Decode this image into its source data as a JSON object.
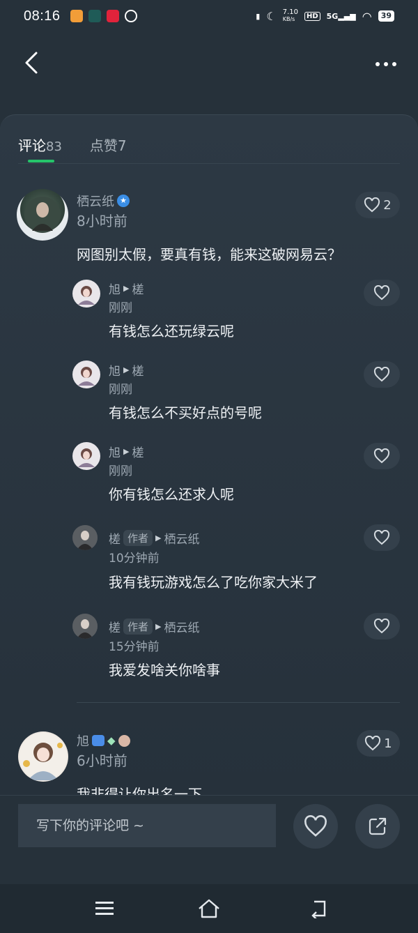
{
  "status": {
    "time": "08:16",
    "net_speed": "7.10",
    "net_unit": "KB/s",
    "hd": "HD",
    "signal": "5G",
    "battery": "39"
  },
  "tabs": [
    {
      "label": "评论",
      "count": "83"
    },
    {
      "label": "点赞7",
      "count": ""
    }
  ],
  "comments": [
    {
      "user": "栖云纸",
      "time": "8小时前",
      "likes": "2",
      "text": "网图别太假，要真有钱，能来这破网易云？",
      "replies": [
        {
          "user": "旭",
          "target": "槎",
          "time": "刚刚",
          "text": "有钱怎么还玩绿云呢"
        },
        {
          "user": "旭",
          "target": "槎",
          "time": "刚刚",
          "text": "有钱怎么不买好点的号呢"
        },
        {
          "user": "旭",
          "target": "槎",
          "time": "刚刚",
          "text": "你有钱怎么还求人呢"
        },
        {
          "user": "槎",
          "badge": "作者",
          "target": "栖云纸",
          "time": "10分钟前",
          "text": "我有钱玩游戏怎么了吃你家大米了"
        },
        {
          "user": "槎",
          "badge": "作者",
          "target": "栖云纸",
          "time": "15分钟前",
          "text": "我爱发啥关你啥事"
        }
      ]
    },
    {
      "user": "旭",
      "time": "6小时前",
      "likes": "1",
      "text": "我非得让你出名一下"
    }
  ],
  "composer": {
    "placeholder": "写下你的评论吧 ~"
  },
  "colors": {
    "accent": "#25c46a",
    "background": "#26313a",
    "button": "#34404b"
  }
}
